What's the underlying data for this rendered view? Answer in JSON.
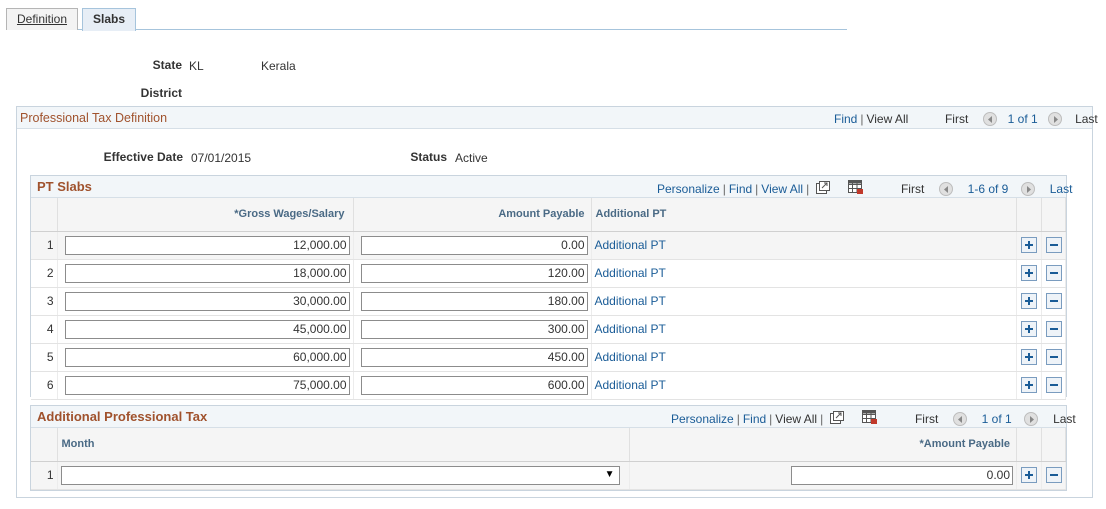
{
  "tabs": [
    {
      "label": "Definition",
      "accesskey_underline": "D"
    },
    {
      "label": "Slabs"
    }
  ],
  "header": {
    "state_label": "State",
    "state_code": "KL",
    "state_name": "Kerala",
    "district_label": "District"
  },
  "pt_definition": {
    "title": "Professional Tax Definition",
    "nav": {
      "find": "Find",
      "view_all": "View All",
      "first": "First",
      "count": "1 of 1",
      "last": "Last"
    },
    "effective_date_label": "Effective Date",
    "effective_date": "07/01/2015",
    "status_label": "Status",
    "status": "Active"
  },
  "pt_slabs": {
    "title": "PT Slabs",
    "nav": {
      "personalize": "Personalize",
      "find": "Find",
      "view_all": "View All",
      "first": "First",
      "count": "1-6 of 9",
      "last": "Last"
    },
    "columns": [
      "*Gross Wages/Salary",
      "Amount Payable",
      "Additional PT"
    ],
    "rows": [
      {
        "num": "1",
        "gross": "12,000.00",
        "amount": "0.00",
        "link": "Additional PT"
      },
      {
        "num": "2",
        "gross": "18,000.00",
        "amount": "120.00",
        "link": "Additional PT"
      },
      {
        "num": "3",
        "gross": "30,000.00",
        "amount": "180.00",
        "link": "Additional PT"
      },
      {
        "num": "4",
        "gross": "45,000.00",
        "amount": "300.00",
        "link": "Additional PT"
      },
      {
        "num": "5",
        "gross": "60,000.00",
        "amount": "450.00",
        "link": "Additional PT"
      },
      {
        "num": "6",
        "gross": "75,000.00",
        "amount": "600.00",
        "link": "Additional PT"
      }
    ]
  },
  "additional_pt": {
    "title": "Additional Professional Tax",
    "nav": {
      "personalize": "Personalize",
      "find": "Find",
      "view_all": "View All",
      "first": "First",
      "count": "1 of 1",
      "last": "Last"
    },
    "columns": [
      "Month",
      "*Amount Payable"
    ],
    "rows": [
      {
        "num": "1",
        "month": "",
        "amount": "0.00"
      }
    ]
  },
  "icons": {
    "add": "plus-icon",
    "delete": "minus-icon",
    "zoom": "zoom-icon",
    "download": "grid-download-icon",
    "prev": "prev-arrow-icon",
    "next": "next-arrow-icon"
  },
  "colors": {
    "accent": "#1a5c97",
    "title": "#a0522d",
    "header_bg": "#f2f6f9"
  }
}
